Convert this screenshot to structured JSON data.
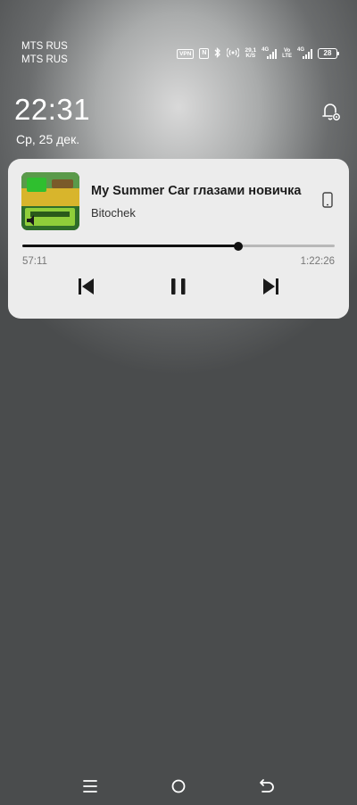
{
  "status_bar": {
    "carrier_1": "MTS RUS",
    "carrier_2": "MTS RUS",
    "vpn_label": "VPN",
    "nfc_label": "N",
    "speed_value": "29,1",
    "speed_unit": "K/S",
    "network_1_tag": "4G",
    "network_2_tag": "4G",
    "volte_top": "Vo",
    "volte_bottom": "LTE",
    "battery_level": "28"
  },
  "lockscreen": {
    "time": "22:31",
    "date": "Ср, 25 дек."
  },
  "media_player": {
    "track_title": "My Summer Car глазами новичка",
    "artist": "Bitochek",
    "elapsed": "57:11",
    "total": "1:22:26",
    "progress_fraction": 0.692
  },
  "icons": {
    "notification_settings": "bell-gear-icon",
    "output_device": "phone-device-icon",
    "previous": "skip-previous-icon",
    "pause": "pause-icon",
    "next": "skip-next-icon",
    "nav_recents": "menu-lines-icon",
    "nav_home": "circle-home-icon",
    "nav_back": "back-arrow-icon"
  },
  "colors": {
    "card_background": "#ececec",
    "progress_played": "#111111",
    "progress_remaining": "#b8b8b8"
  }
}
